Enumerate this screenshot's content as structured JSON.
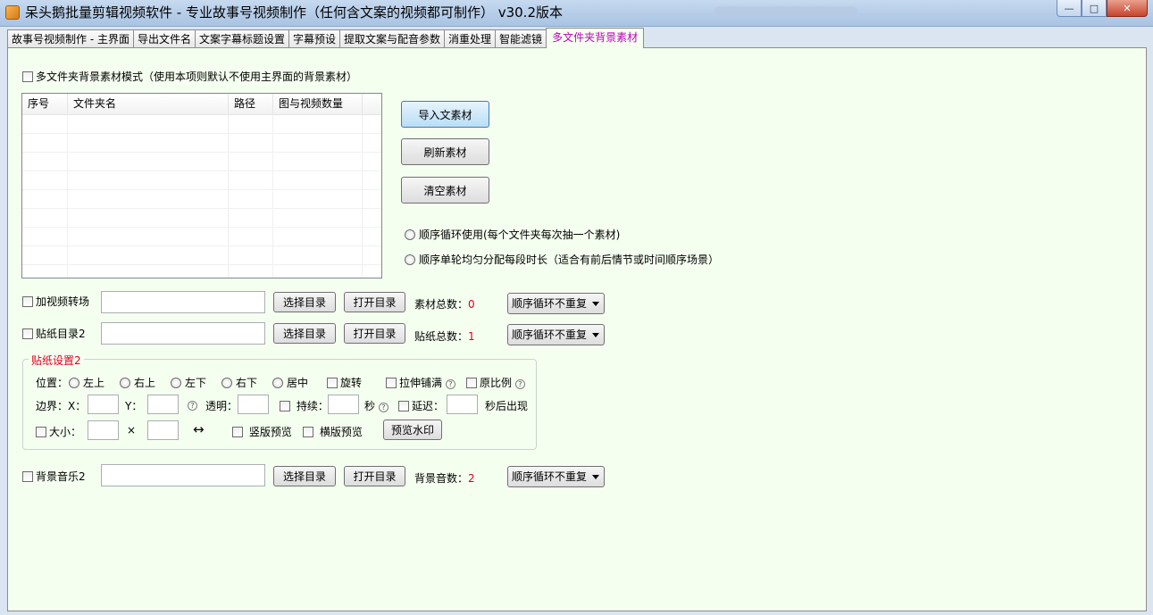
{
  "window": {
    "title": "呆头鹅批量剪辑视频软件 -  专业故事号视频制作（任何含文案的视频都可制作） v30.2版本",
    "min_glyph": "—",
    "max_glyph": "□",
    "close_glyph": "✕"
  },
  "tabs": [
    {
      "label": "故事号视频制作 - 主界面",
      "active": false
    },
    {
      "label": "导出文件名",
      "active": false
    },
    {
      "label": "文案字幕标题设置",
      "active": false
    },
    {
      "label": "字幕预设",
      "active": false
    },
    {
      "label": "提取文案与配音参数",
      "active": false
    },
    {
      "label": "消重处理",
      "active": false
    },
    {
      "label": "智能滤镜",
      "active": false
    },
    {
      "label": "多文件夹背景素材",
      "active": true
    }
  ],
  "mode": {
    "label": "多文件夹背景素材模式（使用本项则默认不使用主界面的背景素材）"
  },
  "list": {
    "columns": [
      "序号",
      "文件夹名",
      "路径",
      "图与视频数量"
    ]
  },
  "buttons": {
    "import": "导入文素材",
    "refresh": "刷新素材",
    "clear": "清空素材",
    "choose_dir": "选择目录",
    "open_dir": "打开目录",
    "preview_watermark": "预览水印"
  },
  "order_options": {
    "seq_loop": "顺序循环使用(每个文件夹每次抽一个素材)",
    "seq_round": "顺序单轮均匀分配每段时长（适合有前后情节或时间顺序场景）"
  },
  "transition": {
    "label": "加视频转场",
    "count_label": "素材总数：",
    "count": "0",
    "mode": "顺序循环不重复"
  },
  "sticker_dir": {
    "label": "贴纸目录2",
    "count_label": "贴纸总数：",
    "count": "1",
    "mode": "顺序循环不重复"
  },
  "sticker_settings": {
    "title": "贴纸设置2",
    "position_label": "位置：",
    "positions": [
      "左上",
      "右上",
      "左下",
      "右下",
      "居中"
    ],
    "rotate": "旋转",
    "stretch": "拉伸铺满",
    "ratio": "原比例",
    "border_label": "边界：X：",
    "y_label": "Y：",
    "opacity_label": "透明：",
    "duration_label": "持续：",
    "seconds": "秒",
    "delay_label": "延迟：",
    "appear_after": "秒后出现",
    "size_label": "大小：",
    "times": "×",
    "swap": "↔",
    "portrait_preview": "竖版预览",
    "landscape_preview": "横版预览",
    "help": "?"
  },
  "bg_music": {
    "label": "背景音乐2",
    "count_label": "背景音数：",
    "count": "2",
    "mode": "顺序循环不重复"
  }
}
